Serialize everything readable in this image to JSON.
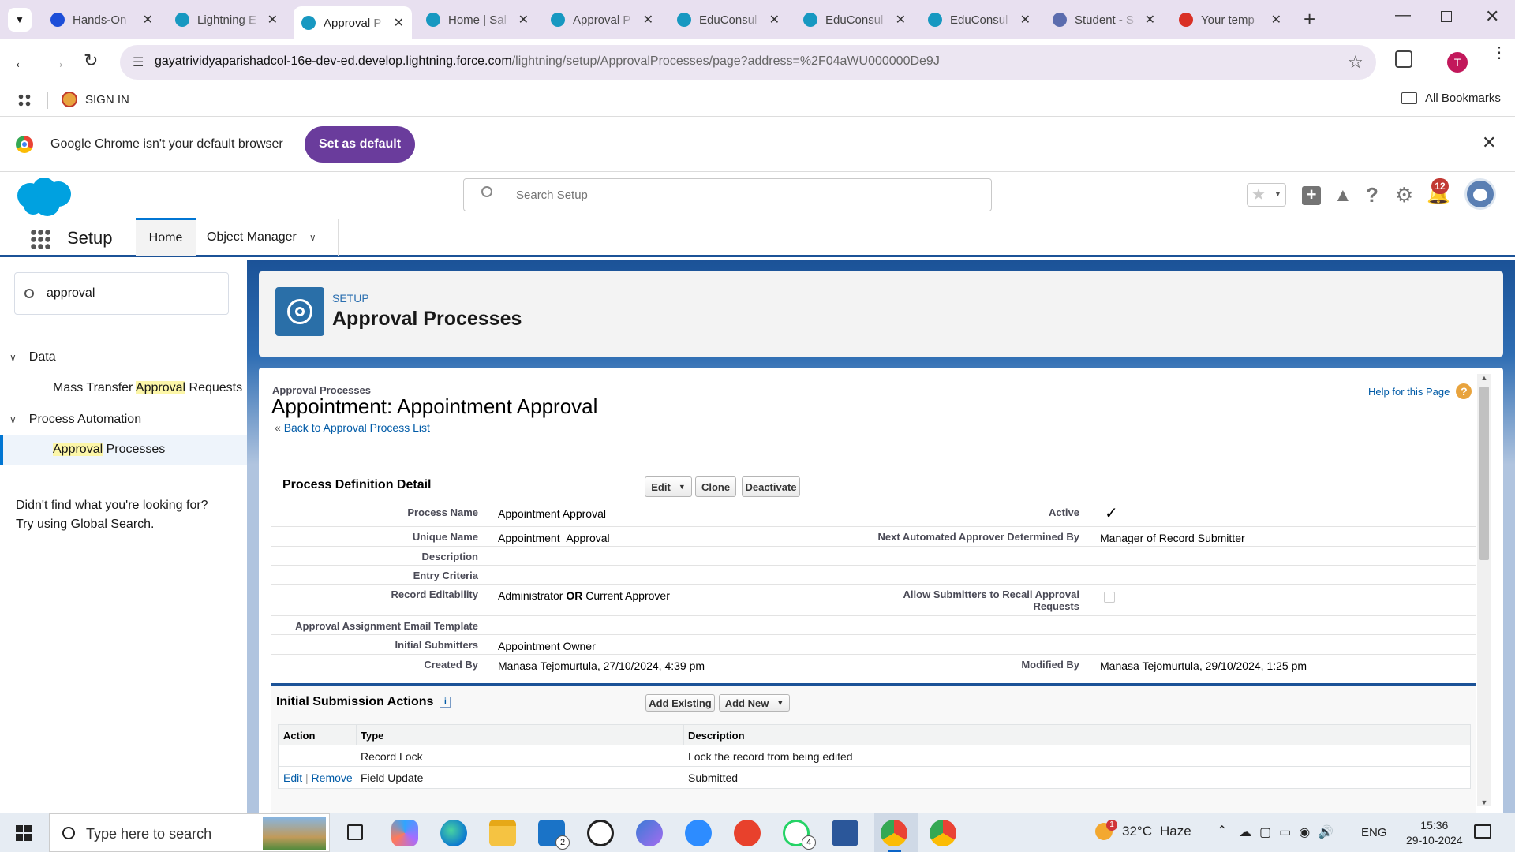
{
  "browser": {
    "tabs": [
      {
        "title": "Hands-On",
        "color": "#1d4ed8"
      },
      {
        "title": "Lightning E",
        "color": "#1798c1"
      },
      {
        "title": "Approval P",
        "color": "#1798c1",
        "active": true
      },
      {
        "title": "Home | Sal",
        "color": "#1798c1"
      },
      {
        "title": "Approval P",
        "color": "#1798c1"
      },
      {
        "title": "EduConsul",
        "color": "#1798c1"
      },
      {
        "title": "EduConsul",
        "color": "#1798c1"
      },
      {
        "title": "EduConsul",
        "color": "#1798c1"
      },
      {
        "title": "Student - S",
        "color": "#5b6cae"
      },
      {
        "title": "Your temp",
        "color": "#d93025"
      }
    ],
    "url_host": "gayatrividyaparishadcol-16e-dev-ed.develop.lightning.force.com",
    "url_path": "/lightning/setup/ApprovalProcesses/page?address=%2F04aWU000000De9J",
    "profile_initial": "T",
    "bookmark_signin": "SIGN IN",
    "all_bookmarks": "All Bookmarks",
    "infobar_text": "Google Chrome isn't your default browser",
    "set_default": "Set as default"
  },
  "sf": {
    "search_placeholder": "Search Setup",
    "notif_count": "12",
    "app_name": "Setup",
    "nav_home": "Home",
    "nav_object_manager": "Object Manager",
    "sidebar": {
      "search_value": "approval",
      "group_data": "Data",
      "item_mass_pre": "Mass Transfer ",
      "item_mass_hl": "Approval",
      "item_mass_post": " Requests",
      "group_process": "Process Automation",
      "item_ap_hl": "Approval",
      "item_ap_post": " Processes",
      "help1": "Didn't find what you're looking for?",
      "help2": "Try using Global Search."
    },
    "header": {
      "eyebrow": "SETUP",
      "title": "Approval Processes"
    },
    "detail": {
      "breadcrumb": "Approval Processes",
      "title": "Appointment: Appointment Approval",
      "back_link": "Back to Approval Process List",
      "help_link": "Help for this Page",
      "section_title": "Process Definition Detail",
      "btn_edit": "Edit",
      "btn_clone": "Clone",
      "btn_deactivate": "Deactivate",
      "fields": {
        "process_name_l": "Process Name",
        "process_name_v": "Appointment Approval",
        "active_l": "Active",
        "unique_name_l": "Unique Name",
        "unique_name_v": "Appointment_Approval",
        "next_approver_l": "Next Automated Approver Determined By",
        "next_approver_v": "Manager of Record Submitter",
        "description_l": "Description",
        "entry_criteria_l": "Entry Criteria",
        "record_edit_l": "Record Editability",
        "record_edit_v1": "Administrator ",
        "record_edit_or": "OR",
        "record_edit_v2": " Current Approver",
        "allow_recall_l1": "Allow Submitters to Recall Approval",
        "allow_recall_l2": "Requests",
        "email_tpl_l": "Approval Assignment Email Template",
        "init_sub_l": "Initial Submitters",
        "init_sub_v": "Appointment Owner",
        "created_by_l": "Created By",
        "created_by_user": "Manasa Tejomurtula",
        "created_by_date": ", 27/10/2024, 4:39 pm",
        "modified_by_l": "Modified By",
        "modified_by_user": "Manasa Tejomurtula",
        "modified_by_date": ", 29/10/2024, 1:25 pm"
      },
      "isa": {
        "title": "Initial Submission Actions",
        "btn_add_existing": "Add Existing",
        "btn_add_new": "Add New",
        "columns": [
          "Action",
          "Type",
          "Description"
        ],
        "rows": [
          {
            "action_edit": "",
            "action_remove": "",
            "type": "Record Lock",
            "description": "Lock the record from being edited",
            "desc_link": false
          },
          {
            "action_edit": "Edit",
            "action_remove": "Remove",
            "type": "Field Update",
            "description": "Submitted",
            "desc_link": true
          }
        ]
      }
    }
  },
  "taskbar": {
    "search_placeholder": "Type here to search",
    "mail_badge": "2",
    "whatsapp_badge": "4",
    "weather_temp": "32°C",
    "weather_desc": "Haze",
    "weather_badge": "1",
    "lang": "ENG",
    "time": "15:36",
    "date": "29-10-2024"
  }
}
